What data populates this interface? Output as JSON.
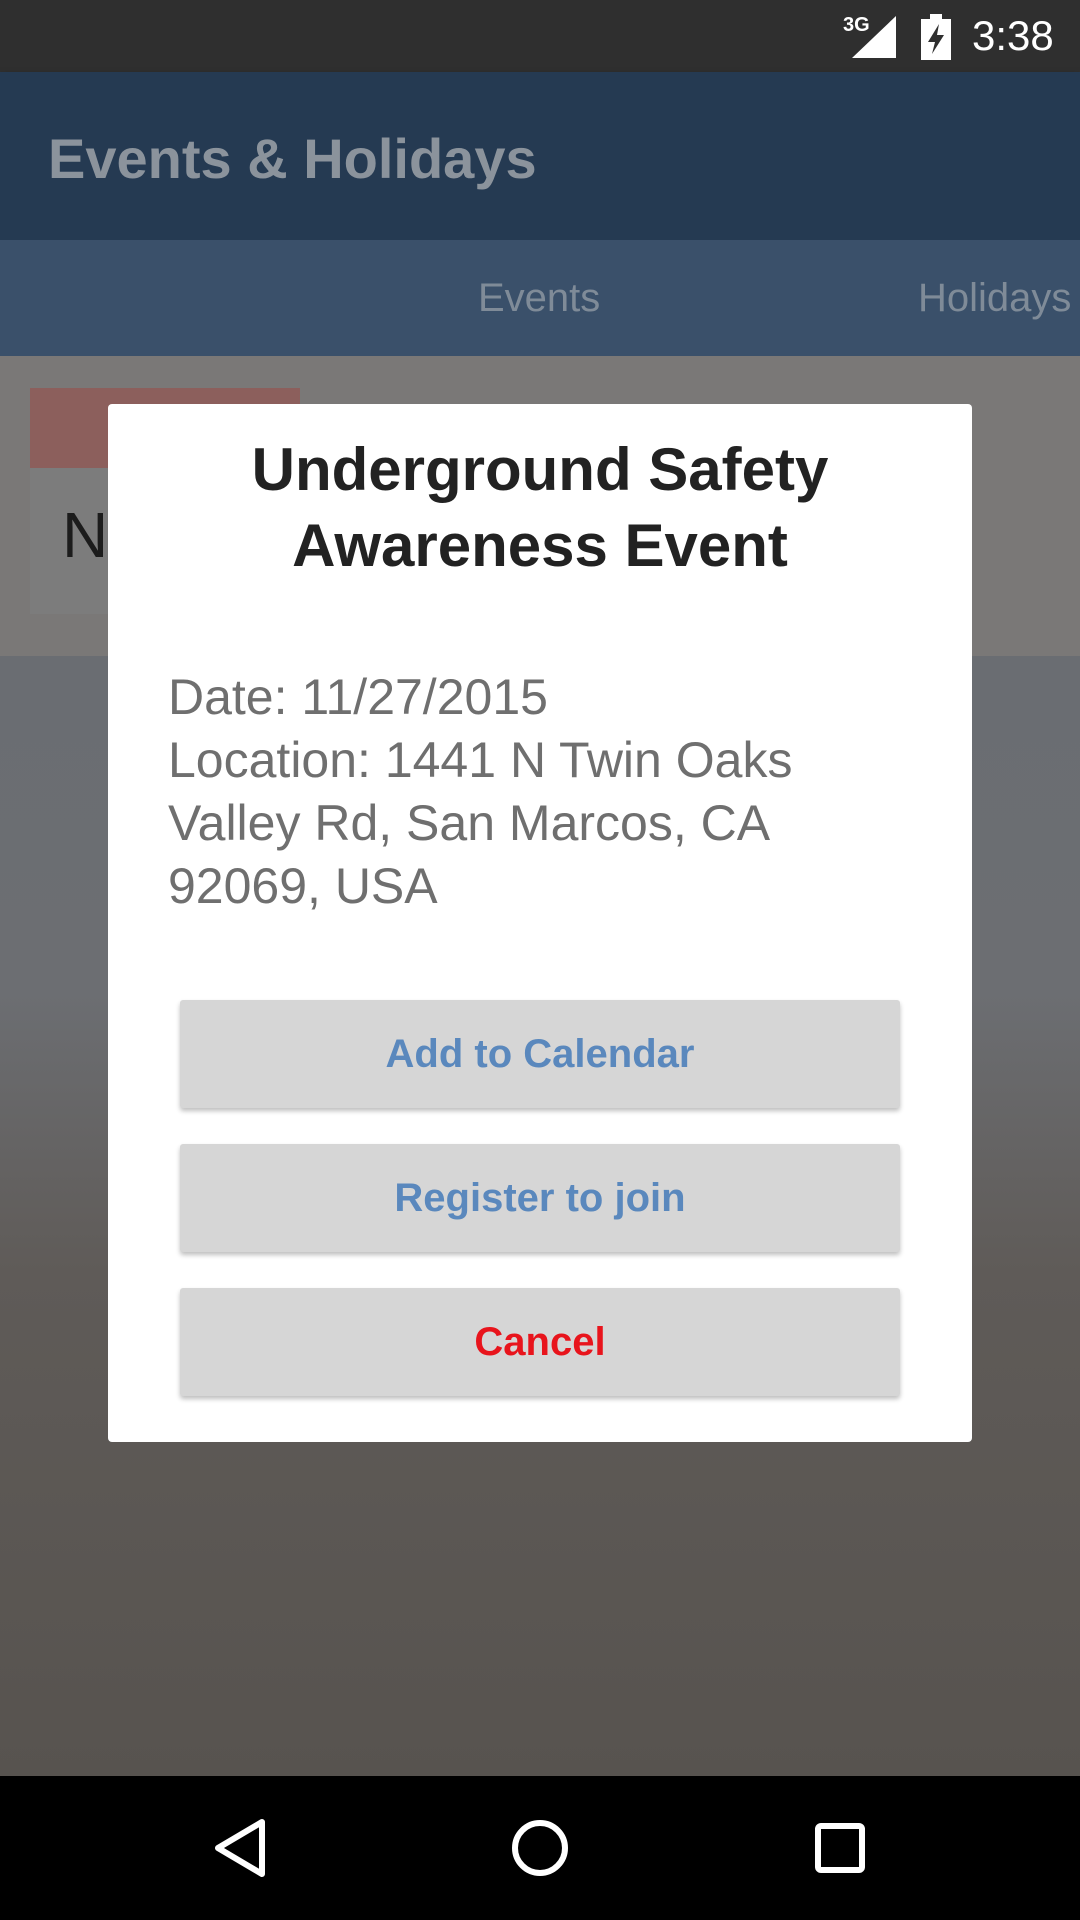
{
  "status_bar": {
    "network": "3G",
    "time": "3:38"
  },
  "app_bar": {
    "title": "Events & Holidays"
  },
  "tabs": [
    {
      "label": "Events"
    },
    {
      "label": "Holidays"
    }
  ],
  "background_card": {
    "letter": "N"
  },
  "dialog": {
    "title": "Underground Safety Awareness Event",
    "date_line": "Date: 11/27/2015",
    "location_line1": "Location: 1441 N Twin Oaks",
    "location_line2": "Valley Rd, San Marcos, CA",
    "location_line3": "92069, USA",
    "buttons": {
      "add_to_calendar": "Add to Calendar",
      "register": "Register to join",
      "cancel": "Cancel"
    }
  },
  "colors": {
    "action_blue": "#5a88bd",
    "cancel_red": "#e8141c",
    "app_bar": "#253a52"
  },
  "icons": {
    "back": "back-icon",
    "home": "home-icon",
    "recents": "recents-icon",
    "signal": "signal-icon",
    "battery": "battery-charging-icon"
  }
}
